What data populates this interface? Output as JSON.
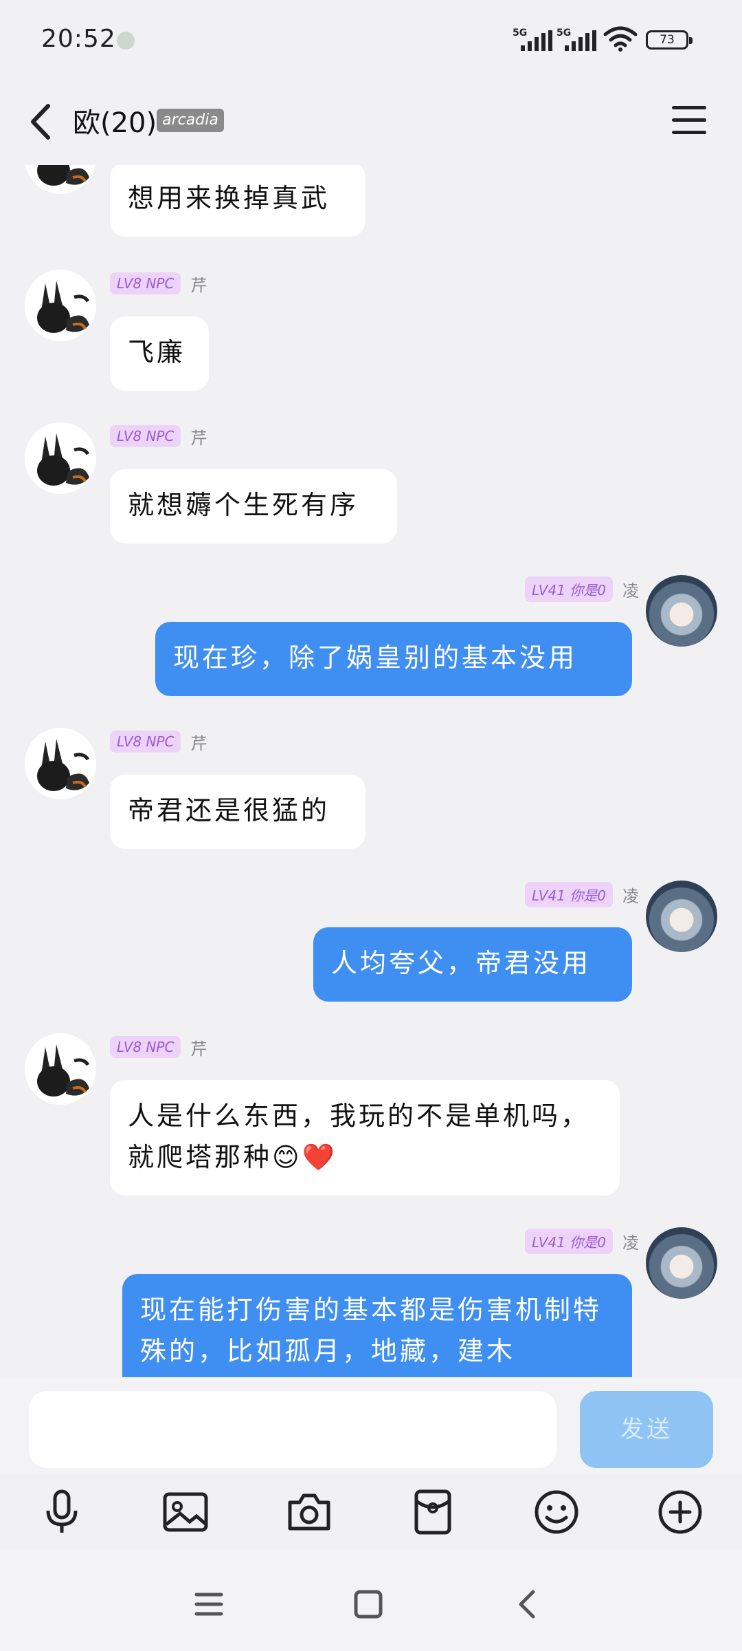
{
  "status": {
    "time": "20:52",
    "network1": "5G",
    "network2": "5G",
    "battery": "73"
  },
  "header": {
    "title": "欧(20)",
    "tag": "arcadia"
  },
  "messages": [
    {
      "side": "in",
      "badge": "",
      "name": "",
      "text": "想用来换掉真武"
    },
    {
      "side": "in",
      "badge": "LV8 NPC",
      "name": "芹",
      "text": "飞廉"
    },
    {
      "side": "in",
      "badge": "LV8 NPC",
      "name": "芹",
      "text": "就想薅个生死有序"
    },
    {
      "side": "out",
      "badge": "LV41 你是0",
      "name": "凌",
      "text": "现在珍，除了娲皇别的基本没用"
    },
    {
      "side": "in",
      "badge": "LV8 NPC",
      "name": "芹",
      "text": "帝君还是很猛的"
    },
    {
      "side": "out",
      "badge": "LV41 你是0",
      "name": "凌",
      "text": "人均夸父，帝君没用"
    },
    {
      "side": "in",
      "badge": "LV8 NPC",
      "name": "芹",
      "text": "人是什么东西，我玩的不是单机吗，就爬塔那种😊❤️"
    },
    {
      "side": "out",
      "badge": "LV41 你是0",
      "name": "凌",
      "text": "现在能打伤害的基本都是伤害机制特殊的，比如孤月，地藏，建木"
    }
  ],
  "input": {
    "placeholder": "",
    "send_label": "发送"
  },
  "toolbar": [
    "mic-icon",
    "image-icon",
    "camera-icon",
    "red-packet-icon",
    "emoji-icon",
    "plus-icon"
  ],
  "nav": [
    "menu-nav-icon",
    "home-nav-icon",
    "back-nav-icon"
  ],
  "colors": {
    "bubble_out": "#3f8ef1",
    "bubble_in": "#ffffff",
    "badge_bg": "#ecd3f7",
    "badge_text": "#9b5bd6"
  }
}
